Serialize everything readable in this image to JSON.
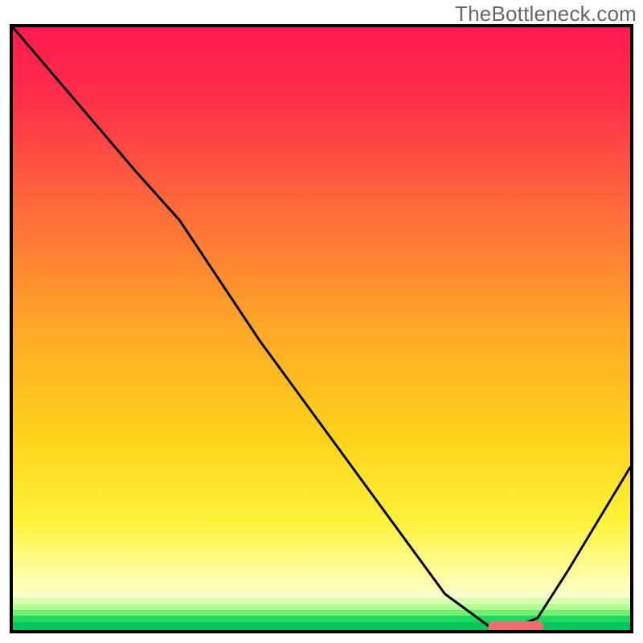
{
  "watermark": "TheBottleneck.com",
  "chart_data": {
    "type": "line",
    "title": "",
    "xlabel": "",
    "ylabel": "",
    "xlim": [
      0,
      100
    ],
    "ylim": [
      0,
      100
    ],
    "grid": false,
    "series": [
      {
        "name": "curve",
        "x": [
          0,
          10,
          20,
          27,
          40,
          55,
          70,
          78,
          80,
          85,
          90,
          100
        ],
        "y": [
          100,
          88,
          76,
          68,
          48,
          27,
          6,
          0,
          0,
          2,
          10,
          27
        ]
      }
    ],
    "min_marker": {
      "x_start": 77,
      "x_end": 86,
      "y": 0
    },
    "colors": {
      "curve": "#000000",
      "marker": "#ef6f6f",
      "gradient_top": "#ff1a4f",
      "gradient_bottom": "#00c85c"
    }
  }
}
